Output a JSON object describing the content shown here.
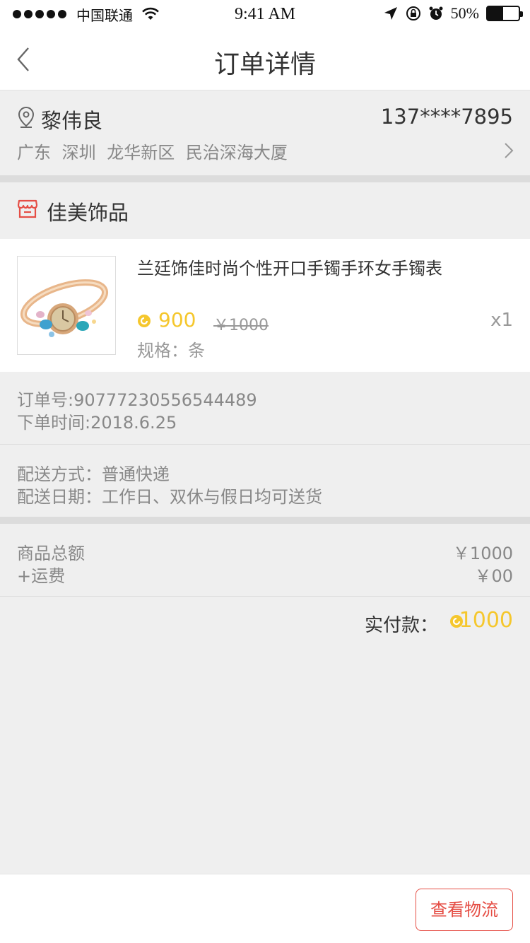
{
  "status_bar": {
    "carrier": "中国联通",
    "time": "9:41 AM",
    "battery": "50%",
    "battery_level": 0.5
  },
  "nav": {
    "title": "订单详情"
  },
  "address": {
    "name": "黎伟良",
    "phone": "137****7895",
    "detail": "广东 深圳 龙华新区 民治深海大厦"
  },
  "shop": {
    "name": "佳美饰品"
  },
  "product": {
    "title": "兰廷饰佳时尚个性开口手镯手环女手镯表",
    "price": "900",
    "original_price": "￥1000",
    "quantity": "x1",
    "spec": "规格：条"
  },
  "order_info": {
    "order_no": "订单号:90777230556544489",
    "order_time": "下单时间:2018.6.25"
  },
  "delivery": {
    "method": "配送方式：普通快递",
    "date": "配送日期：工作日、双休与假日均可送货"
  },
  "totals": {
    "goods_label": "商品总额",
    "goods_value": "￥1000",
    "shipping_label": "+运费",
    "shipping_value": "￥00"
  },
  "payment": {
    "label": "实付款：",
    "value": "1000"
  },
  "bottom": {
    "logistics_button": "查看物流"
  },
  "colors": {
    "accent": "#e54e45",
    "price": "#f5c72d",
    "background": "#efefef"
  },
  "icons": [
    "back-arrow-icon",
    "location-pin-icon",
    "chevron-right-icon",
    "store-icon",
    "coin-icon",
    "wifi-icon",
    "location-arrow-icon",
    "lock-rotation-icon",
    "alarm-icon"
  ]
}
